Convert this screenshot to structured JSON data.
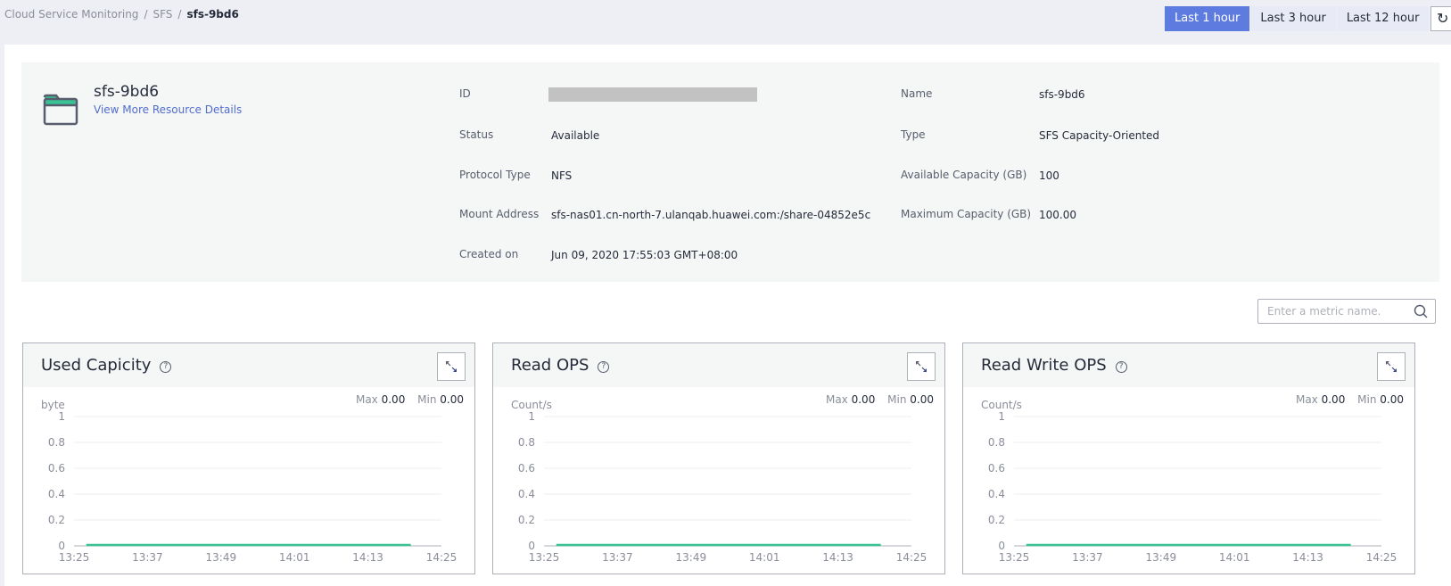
{
  "breadcrumb": {
    "items": [
      "Cloud Service Monitoring",
      "SFS",
      "sfs-9bd6"
    ],
    "separator": "/"
  },
  "time_range": {
    "options": [
      "Last 1 hour",
      "Last 3 hour",
      "Last 12 hour"
    ],
    "selected": "Last 1 hour",
    "refresh_icon": "refresh-icon"
  },
  "resource": {
    "icon": "folder-icon",
    "name": "sfs-9bd6",
    "details_link": "View More Resource Details",
    "fields_left": [
      {
        "label": "ID",
        "value": "",
        "redacted": true
      },
      {
        "label": "Status",
        "value": "Available"
      },
      {
        "label": "Protocol Type",
        "value": "NFS"
      },
      {
        "label": "Mount Address",
        "value": "sfs-nas01.cn-north-7.ulanqab.huawei.com:/share-04852e5c"
      },
      {
        "label": "Created on",
        "value": "Jun 09, 2020 17:55:03 GMT+08:00"
      }
    ],
    "fields_right": [
      {
        "label": "Name",
        "value": "sfs-9bd6"
      },
      {
        "label": "Type",
        "value": "SFS Capacity-Oriented"
      },
      {
        "label": "Available Capacity (GB)",
        "value": "100"
      },
      {
        "label": "Maximum Capacity (GB)",
        "value": "100.00"
      }
    ]
  },
  "search": {
    "placeholder": "Enter a metric name.",
    "value": ""
  },
  "colors": {
    "accent": "#5e7ce0",
    "series": "#3ac295",
    "link": "#526ecc"
  },
  "chart_data": [
    {
      "type": "line",
      "title": "Used Capicity",
      "ylabel": "byte",
      "xlabel": "",
      "max_label": "Max",
      "max_value": "0.00",
      "min_label": "Min",
      "min_value": "0.00",
      "ylim": [
        0,
        1
      ],
      "yticks": [
        "0",
        "0.2",
        "0.4",
        "0.6",
        "0.8",
        "1"
      ],
      "xticks": [
        "13:25",
        "13:37",
        "13:49",
        "14:01",
        "14:13",
        "14:25"
      ],
      "series": [
        {
          "name": "Used Capicity",
          "x_range": [
            "13:27",
            "14:20"
          ],
          "values": [
            0,
            0
          ]
        }
      ],
      "grid": true
    },
    {
      "type": "line",
      "title": "Read OPS",
      "ylabel": "Count/s",
      "xlabel": "",
      "max_label": "Max",
      "max_value": "0.00",
      "min_label": "Min",
      "min_value": "0.00",
      "ylim": [
        0,
        1
      ],
      "yticks": [
        "0",
        "0.2",
        "0.4",
        "0.6",
        "0.8",
        "1"
      ],
      "xticks": [
        "13:25",
        "13:37",
        "13:49",
        "14:01",
        "14:13",
        "14:25"
      ],
      "series": [
        {
          "name": "Read OPS",
          "x_range": [
            "13:27",
            "14:20"
          ],
          "values": [
            0,
            0
          ]
        }
      ],
      "grid": true
    },
    {
      "type": "line",
      "title": "Read Write OPS",
      "ylabel": "Count/s",
      "xlabel": "",
      "max_label": "Max",
      "max_value": "0.00",
      "min_label": "Min",
      "min_value": "0.00",
      "ylim": [
        0,
        1
      ],
      "yticks": [
        "0",
        "0.2",
        "0.4",
        "0.6",
        "0.8",
        "1"
      ],
      "xticks": [
        "13:25",
        "13:37",
        "13:49",
        "14:01",
        "14:13",
        "14:25"
      ],
      "series": [
        {
          "name": "Read Write OPS",
          "x_range": [
            "13:27",
            "14:20"
          ],
          "values": [
            0,
            0
          ]
        }
      ],
      "grid": true
    }
  ]
}
